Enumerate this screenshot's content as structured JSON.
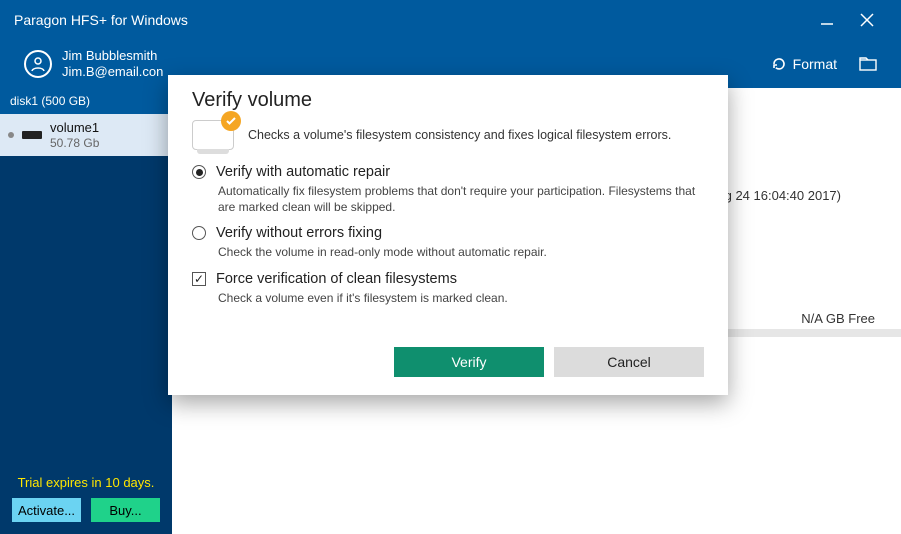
{
  "title": "Paragon HFS+ for Windows",
  "user": {
    "name": "Jim Bubblesmith",
    "email": "Jim.B@email.con"
  },
  "toolbar": {
    "format": "Format"
  },
  "sidebar": {
    "disk_header": "disk1 (500 GB)",
    "volume": {
      "name": "volume1",
      "size": "50.78 Gb"
    },
    "trial": "Trial expires in 10 days.",
    "activate": "Activate...",
    "buy": "Buy..."
  },
  "content": {
    "info_fragment": "g 24 16:04:40 2017)",
    "free": "N/A GB Free"
  },
  "dialog": {
    "title": "Verify volume",
    "subtitle": "Checks a volume's filesystem consistency and fixes logical filesystem errors.",
    "opt1": {
      "label": "Verify with automatic repair",
      "desc": "Automatically fix filesystem problems that don't require your participation. Filesystems that are marked clean will be skipped."
    },
    "opt2": {
      "label": "Verify without errors fixing",
      "desc": "Check the volume in read-only mode without automatic repair."
    },
    "opt3": {
      "label": "Force verification of clean filesystems",
      "desc": "Check a volume even if it's filesystem is marked clean."
    },
    "verify": "Verify",
    "cancel": "Cancel"
  }
}
